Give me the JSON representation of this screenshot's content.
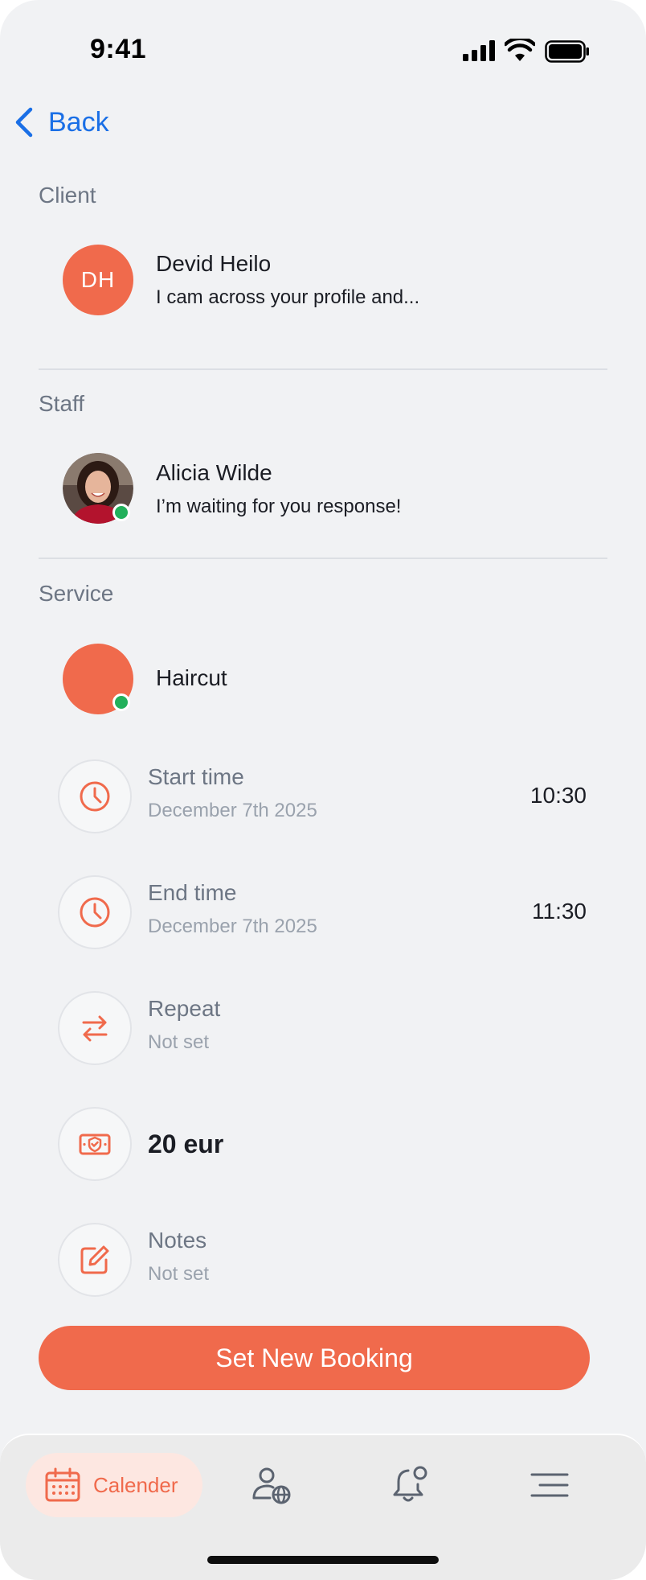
{
  "status_bar": {
    "time": "9:41"
  },
  "nav": {
    "back_label": "Back"
  },
  "client": {
    "section_label": "Client",
    "initials": "DH",
    "name": "Devid Heilo",
    "message": "I cam across your profile and..."
  },
  "staff": {
    "section_label": "Staff",
    "name": "Alicia Wilde",
    "message": "I’m waiting for you response!"
  },
  "service": {
    "section_label": "Service",
    "name": "Haircut",
    "start": {
      "title": "Start time",
      "date": "December 7th 2025",
      "time": "10:30"
    },
    "end": {
      "title": "End time",
      "date": "December 7th 2025",
      "time": "11:30"
    },
    "repeat": {
      "title": "Repeat",
      "value": "Not set"
    },
    "price": "20 eur",
    "notes": {
      "title": "Notes",
      "value": "Not set"
    }
  },
  "cta_label": "Set New Booking",
  "bottom_nav": {
    "active_label": "Calender",
    "items": [
      "calendar-icon",
      "client-globe-icon",
      "notification-bell-icon",
      "menu-icon"
    ]
  },
  "colors": {
    "accent": "#f06a4c",
    "link": "#1a6fe6",
    "online": "#22b05b"
  }
}
